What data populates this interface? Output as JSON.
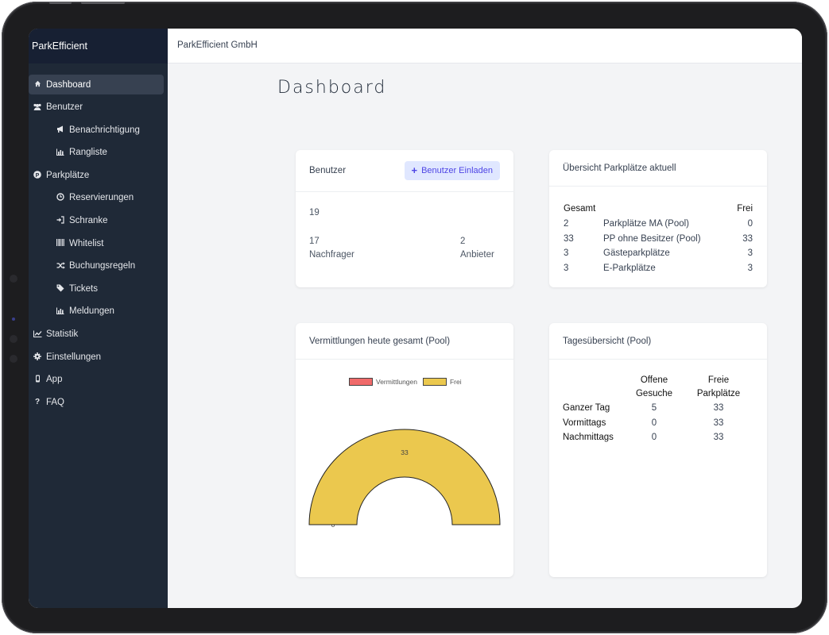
{
  "app": {
    "brand": "ParkEfficient",
    "company": "ParkEfficient GmbH"
  },
  "page": {
    "title": "Dashboard"
  },
  "colors": {
    "sidebar": "#1f2937",
    "accent": "#4f46e5",
    "series_vermittlungen": "#f06a6a",
    "series_frei": "#ebc84e"
  },
  "sidebar": {
    "items": [
      {
        "label": "Dashboard",
        "icon": "home-icon"
      },
      {
        "label": "Benutzer",
        "icon": "users-icon"
      },
      {
        "label": "Benachrichtigung",
        "icon": "bullhorn-icon"
      },
      {
        "label": "Rangliste",
        "icon": "bar-chart-icon"
      },
      {
        "label": "Parkplätze",
        "icon": "parking-icon"
      },
      {
        "label": "Reservierungen",
        "icon": "clock-icon"
      },
      {
        "label": "Schranke",
        "icon": "sign-in-icon"
      },
      {
        "label": "Whitelist",
        "icon": "barcode-icon"
      },
      {
        "label": "Buchungsregeln",
        "icon": "shuffle-icon"
      },
      {
        "label": "Tickets",
        "icon": "tag-icon"
      },
      {
        "label": "Meldungen",
        "icon": "bar-chart-icon"
      },
      {
        "label": "Statistik",
        "icon": "line-chart-icon"
      },
      {
        "label": "Einstellungen",
        "icon": "gear-icon"
      },
      {
        "label": "App",
        "icon": "mobile-icon"
      },
      {
        "label": "FAQ",
        "icon": "question-icon"
      }
    ]
  },
  "users_card": {
    "title": "Benutzer",
    "invite_label": "Benutzer Einladen",
    "total": "19",
    "nachfrager_count": "17",
    "nachfrager_label": "Nachfrager",
    "anbieter_count": "2",
    "anbieter_label": "Anbieter"
  },
  "parking_card": {
    "title": "Übersicht Parkplätze aktuell",
    "col_total": "Gesamt",
    "col_free": "Frei",
    "rows": [
      {
        "total": "2",
        "name": "Parkplätze MA (Pool)",
        "free": "0"
      },
      {
        "total": "33",
        "name": "PP ohne Besitzer (Pool)",
        "free": "33"
      },
      {
        "total": "3",
        "name": "Gästeparkplätze",
        "free": "3"
      },
      {
        "total": "3",
        "name": "E-Parkplätze",
        "free": "3"
      }
    ]
  },
  "chart_card": {
    "title": "Vermittlungen heute gesamt (Pool)"
  },
  "chart_data": {
    "type": "pie",
    "variant": "half-doughnut",
    "categories": [
      "Vermittlungen",
      "Frei"
    ],
    "values": [
      0,
      33
    ],
    "colors": [
      "#f06a6a",
      "#ebc84e"
    ],
    "legend": "top",
    "legend_labels": [
      "Vermittlungen",
      "Frei"
    ],
    "data_labels": [
      "0",
      "33"
    ]
  },
  "day_card": {
    "title": "Tagesübersicht (Pool)",
    "col_open_1": "Offene",
    "col_open_2": "Gesuche",
    "col_free_1": "Freie",
    "col_free_2": "Parkplätze",
    "rows": [
      {
        "label": "Ganzer Tag",
        "open": "5",
        "free": "33"
      },
      {
        "label": "Vormittags",
        "open": "0",
        "free": "33"
      },
      {
        "label": "Nachmittags",
        "open": "0",
        "free": "33"
      }
    ]
  }
}
